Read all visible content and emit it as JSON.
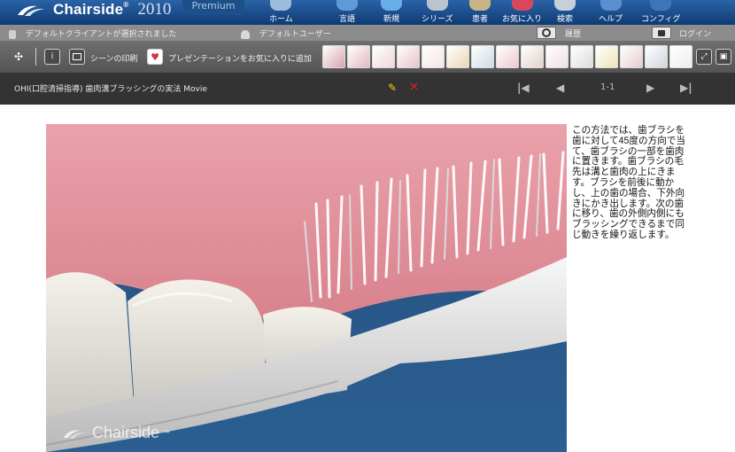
{
  "app": {
    "name": "Chairside",
    "trademark": "®",
    "year": "2010",
    "edition": "Premium"
  },
  "nav": [
    {
      "label": "ホーム",
      "icon": "home-icon"
    },
    {
      "label": "言語",
      "icon": "language-icon"
    },
    {
      "label": "新規",
      "icon": "new-icon"
    },
    {
      "label": "シリーズ",
      "icon": "series-icon"
    },
    {
      "label": "患者",
      "icon": "patient-icon"
    },
    {
      "label": "お気に入り",
      "icon": "favorites-icon"
    },
    {
      "label": "検索",
      "icon": "search-icon"
    },
    {
      "label": "ヘルプ",
      "icon": "help-icon"
    },
    {
      "label": "コンフィグ",
      "icon": "config-icon"
    }
  ],
  "status": {
    "client": "デフォルトクライアントが選択されました",
    "user": "デフォルトユーザー",
    "history": "履歴",
    "login": "ログイン"
  },
  "toolbar": {
    "print_scene": "シーンの印刷",
    "add_favorite": "プレゼンテーションをお気に入りに追加",
    "thumbnail_count": 15
  },
  "titlebar": {
    "title": "OHI(口腔清掃指導) 歯肉溝ブラッシングの実法  Movie",
    "page": "1-1"
  },
  "content": {
    "watermark": "Chairside",
    "watermark_tm": "™",
    "description": "この方法では、歯ブラシを歯に対して45度の方向で当て、歯ブラシの一部を歯肉に置きます。歯ブラシの毛先は溝と歯肉の上にきます。ブラシを前後に動かし、上の歯の場合、下外向きにかき出します。次の歯に移り、歯の外側内側にもブラッシングできるまで同じ動きを繰り返します。"
  },
  "colors": {
    "topbar": "#0f3b74",
    "accent_red": "#e02020",
    "accent_yellow": "#f2d300",
    "gum": "#e4919b",
    "scene_blue": "#2b5f92"
  }
}
